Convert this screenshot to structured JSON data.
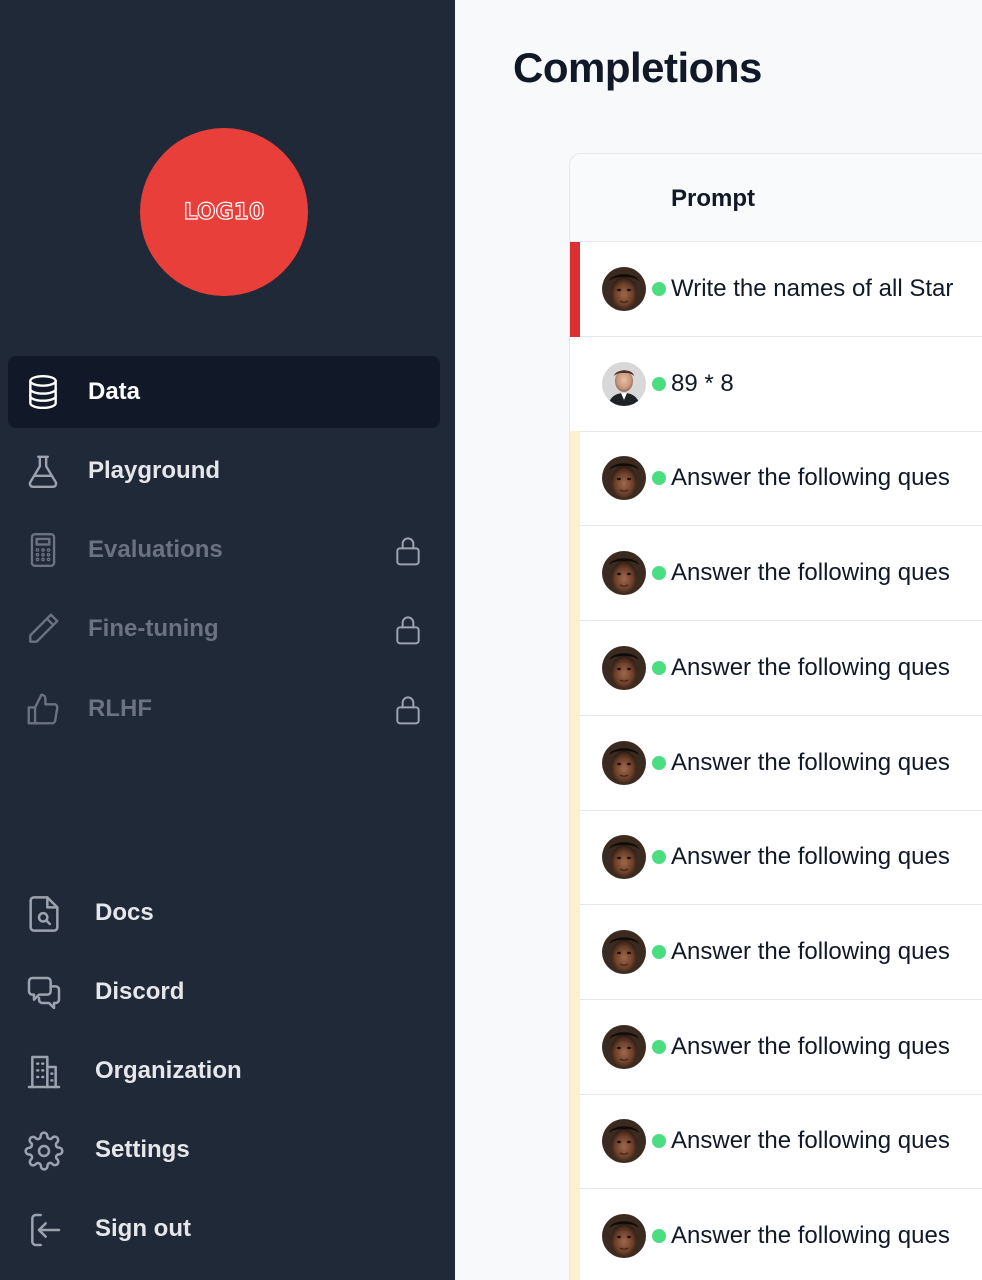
{
  "logo": {
    "text": "LOG10"
  },
  "nav": {
    "items": [
      {
        "label": "Data",
        "icon": "database-icon",
        "active": true,
        "locked": false
      },
      {
        "label": "Playground",
        "icon": "flask-icon",
        "active": false,
        "locked": false
      },
      {
        "label": "Evaluations",
        "icon": "calculator-icon",
        "active": false,
        "locked": true
      },
      {
        "label": "Fine-tuning",
        "icon": "pencil-icon",
        "active": false,
        "locked": true
      },
      {
        "label": "RLHF",
        "icon": "thumbs-up-icon",
        "active": false,
        "locked": true
      }
    ]
  },
  "footer_nav": {
    "items": [
      {
        "label": "Docs",
        "icon": "document-search-icon"
      },
      {
        "label": "Discord",
        "icon": "chat-bubbles-icon"
      },
      {
        "label": "Organization",
        "icon": "building-icon"
      },
      {
        "label": "Settings",
        "icon": "gear-icon"
      },
      {
        "label": "Sign out",
        "icon": "sign-out-icon"
      }
    ]
  },
  "page": {
    "title": "Completions"
  },
  "table": {
    "columns": [
      "Prompt"
    ],
    "rows": [
      {
        "prompt": "Write the names of all Star",
        "status": "error",
        "avatar": "user-a"
      },
      {
        "prompt": "89 * 8",
        "status": "none",
        "avatar": "user-b"
      },
      {
        "prompt": "Answer the following ques",
        "status": "warning",
        "avatar": "user-a"
      },
      {
        "prompt": "Answer the following ques",
        "status": "warning",
        "avatar": "user-a"
      },
      {
        "prompt": "Answer the following ques",
        "status": "warning",
        "avatar": "user-a"
      },
      {
        "prompt": "Answer the following ques",
        "status": "warning",
        "avatar": "user-a"
      },
      {
        "prompt": "Answer the following ques",
        "status": "warning",
        "avatar": "user-a"
      },
      {
        "prompt": "Answer the following ques",
        "status": "warning",
        "avatar": "user-a"
      },
      {
        "prompt": "Answer the following ques",
        "status": "warning",
        "avatar": "user-a"
      },
      {
        "prompt": "Answer the following ques",
        "status": "warning",
        "avatar": "user-a"
      },
      {
        "prompt": "Answer the following ques",
        "status": "warning",
        "avatar": "user-a"
      }
    ]
  },
  "colors": {
    "sidebar_bg": "#1f2937",
    "active_bg": "#111827",
    "logo_bg": "#e83f3a",
    "status_dot": "#4ade80",
    "error_bar": "#dc2f33",
    "warning_bar": "#fbf0cf"
  }
}
